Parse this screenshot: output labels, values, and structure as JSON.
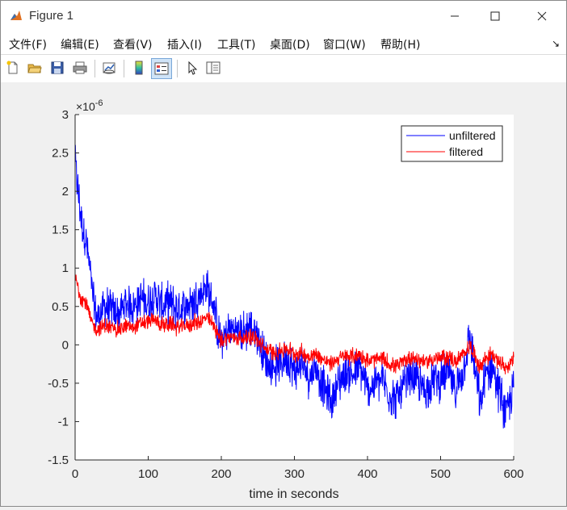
{
  "window": {
    "title": "Figure 1"
  },
  "menu": [
    "文件(F)",
    "编辑(E)",
    "查看(V)",
    "插入(I)",
    "工具(T)",
    "桌面(D)",
    "窗口(W)",
    "帮助(H)"
  ],
  "toolbar": {
    "icons": [
      "new-figure-icon",
      "open-file-icon",
      "save-icon",
      "print-icon",
      "link-plot-icon",
      "insert-colorbar-icon",
      "insert-legend-icon",
      "edit-plot-arrow-icon",
      "property-inspector-icon"
    ]
  },
  "chart_data": {
    "type": "line",
    "xlabel": "time in seconds",
    "ylabel": "",
    "exponent_label": "×10",
    "exponent_power": "-6",
    "xlim": [
      0,
      600
    ],
    "ylim": [
      -1.5,
      3
    ],
    "xticks": [
      0,
      100,
      200,
      300,
      400,
      500,
      600
    ],
    "yticks": [
      -1.5,
      -1,
      -0.5,
      0,
      0.5,
      1,
      1.5,
      2,
      2.5,
      3
    ],
    "yticklabels": [
      "-1.5",
      "-1",
      "-0.5",
      "0",
      "0.5",
      "1",
      "1.5",
      "2",
      "2.5",
      "3"
    ],
    "ytick_scale": 1e-06,
    "legend_placement": "top-right",
    "grid": false,
    "series": [
      {
        "name": "unfiltered",
        "color": "#0000ff",
        "band": 0.22,
        "x": [
          0,
          5,
          10,
          15,
          20,
          25,
          30,
          40,
          50,
          60,
          70,
          80,
          90,
          100,
          110,
          120,
          130,
          140,
          150,
          160,
          170,
          180,
          190,
          195,
          200,
          210,
          220,
          230,
          240,
          250,
          255,
          260,
          270,
          280,
          290,
          300,
          310,
          320,
          330,
          340,
          350,
          360,
          370,
          380,
          390,
          400,
          410,
          420,
          430,
          440,
          450,
          460,
          470,
          480,
          490,
          500,
          510,
          520,
          530,
          540,
          550,
          555,
          560,
          570,
          580,
          590,
          600
        ],
        "y": [
          2.4,
          1.9,
          1.55,
          1.35,
          1.0,
          0.55,
          0.35,
          0.5,
          0.45,
          0.4,
          0.55,
          0.5,
          0.6,
          0.55,
          0.65,
          0.5,
          0.55,
          0.45,
          0.5,
          0.55,
          0.65,
          0.75,
          0.5,
          0.2,
          0.05,
          0.2,
          0.2,
          0.15,
          0.25,
          0.1,
          0.0,
          -0.2,
          -0.3,
          -0.25,
          -0.15,
          -0.35,
          -0.25,
          -0.4,
          -0.3,
          -0.55,
          -0.75,
          -0.5,
          -0.35,
          -0.4,
          -0.3,
          -0.6,
          -0.5,
          -0.45,
          -0.65,
          -0.7,
          -0.55,
          -0.4,
          -0.5,
          -0.6,
          -0.45,
          -0.45,
          -0.35,
          -0.6,
          -0.35,
          0.1,
          -0.5,
          -0.85,
          -0.45,
          -0.25,
          -0.6,
          -0.9,
          -0.55
        ]
      },
      {
        "name": "filtered",
        "color": "#ff0000",
        "band": 0.09,
        "x": [
          0,
          5,
          10,
          15,
          20,
          25,
          30,
          40,
          50,
          60,
          70,
          80,
          90,
          100,
          110,
          120,
          130,
          140,
          150,
          160,
          170,
          180,
          190,
          195,
          200,
          210,
          220,
          230,
          240,
          250,
          255,
          260,
          270,
          280,
          290,
          300,
          310,
          320,
          330,
          340,
          350,
          360,
          370,
          380,
          390,
          400,
          410,
          420,
          430,
          440,
          450,
          460,
          470,
          480,
          490,
          500,
          510,
          520,
          530,
          540,
          550,
          555,
          560,
          570,
          580,
          590,
          600
        ],
        "y": [
          0.9,
          0.7,
          0.6,
          0.55,
          0.35,
          0.25,
          0.2,
          0.25,
          0.22,
          0.2,
          0.25,
          0.22,
          0.28,
          0.3,
          0.32,
          0.25,
          0.28,
          0.22,
          0.25,
          0.28,
          0.3,
          0.35,
          0.25,
          0.15,
          0.05,
          0.1,
          0.1,
          0.08,
          0.12,
          0.05,
          0.0,
          -0.05,
          -0.1,
          -0.08,
          -0.05,
          -0.12,
          -0.1,
          -0.15,
          -0.12,
          -0.2,
          -0.25,
          -0.18,
          -0.15,
          -0.15,
          -0.12,
          -0.22,
          -0.2,
          -0.18,
          -0.25,
          -0.28,
          -0.22,
          -0.15,
          -0.2,
          -0.22,
          -0.18,
          -0.18,
          -0.15,
          -0.22,
          -0.15,
          0.0,
          -0.2,
          -0.3,
          -0.18,
          -0.12,
          -0.22,
          -0.3,
          -0.2
        ]
      }
    ]
  }
}
